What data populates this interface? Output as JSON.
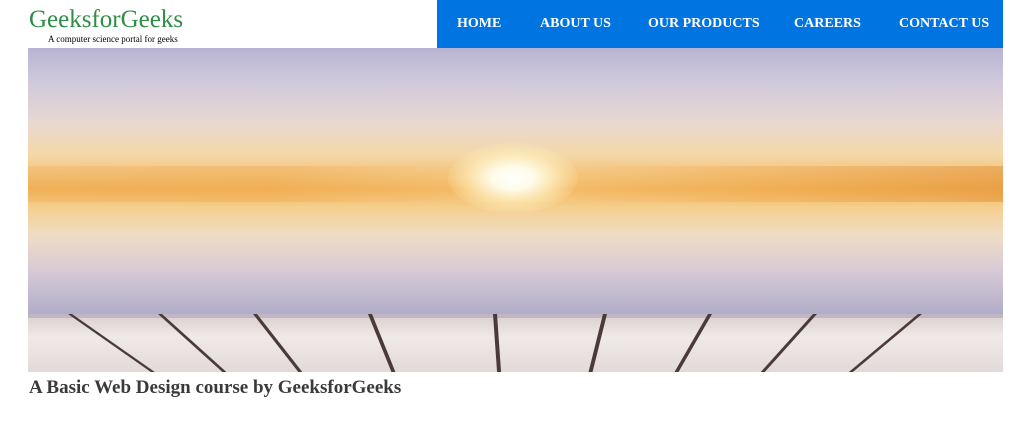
{
  "header": {
    "logo_title": "GeeksforGeeks",
    "logo_tagline": "A computer science portal for geeks"
  },
  "nav": {
    "items": [
      {
        "label": "HOME"
      },
      {
        "label": "ABOUT US"
      },
      {
        "label": "OUR PRODUCTS"
      },
      {
        "label": "CAREERS"
      },
      {
        "label": "CONTACT US"
      }
    ]
  },
  "hero": {
    "image_subject": "sunset-sky-over-wooden-deck"
  },
  "main": {
    "caption": "A Basic Web Design course by GeeksforGeeks"
  },
  "colors": {
    "brand_green": "#2f8d46",
    "nav_blue": "#0074e0",
    "nav_text": "#ffffff",
    "caption_text": "#3a3a3a"
  }
}
